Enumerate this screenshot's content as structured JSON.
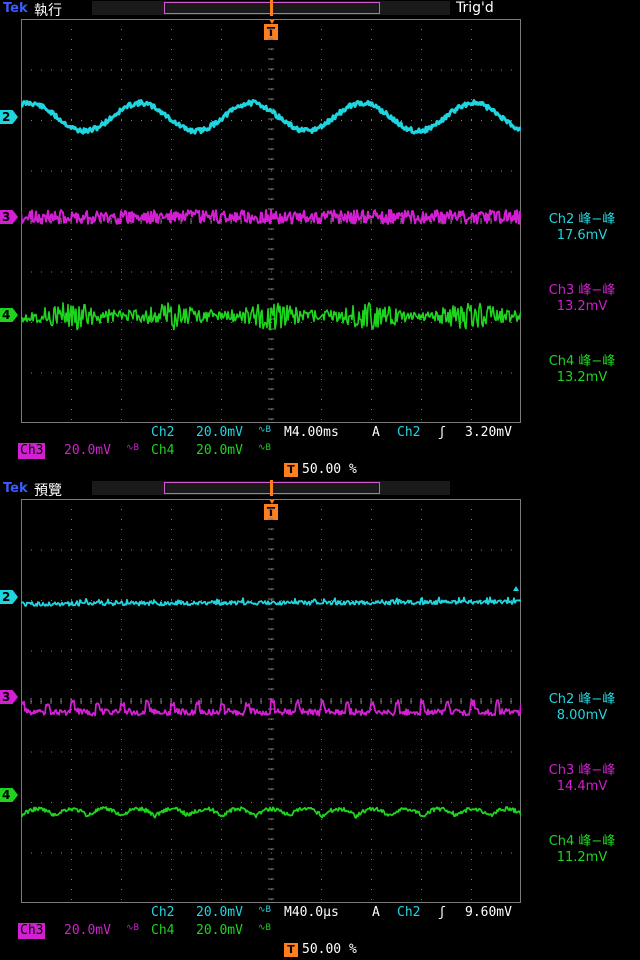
{
  "colors": {
    "ch2": "#1fd6e0",
    "ch3": "#d11fd1",
    "ch4": "#1ed41e",
    "trigger": "#ff7f1f",
    "grid": "#7a7a7a",
    "tek": "#3a5cff"
  },
  "panels": [
    {
      "logo": "Tek",
      "acq_state": "執行",
      "trig_state": "Trig'd",
      "trigger_marker": "T",
      "channel_markers": [
        "2",
        "3",
        "4"
      ],
      "waveforms": {
        "ch2": "sine",
        "ch3": "noise",
        "ch4": "amplitude-modulated"
      },
      "measurements": [
        {
          "title": "Ch2 峰−峰",
          "value": "17.6mV"
        },
        {
          "title": "Ch3 峰−峰",
          "value": "13.2mV"
        },
        {
          "title": "Ch4 峰−峰",
          "value": "13.2mV"
        }
      ],
      "ch2_label": "Ch2",
      "ch2_scale": "20.0mV",
      "bw_icon": "∿B",
      "timebase": "M4.00ms",
      "trig_source_letter": "A",
      "trig_ch": "Ch2",
      "trig_slope_icon": "ʃ",
      "trig_level": "3.20mV",
      "ch3_label": "Ch3",
      "ch3_scale": "20.0mV",
      "ch4_label": "Ch4",
      "ch4_scale": "20.0mV",
      "trig_pos_icon": "T",
      "trig_pos": "50.00 %"
    },
    {
      "logo": "Tek",
      "acq_state": "預覽",
      "trig_state": "",
      "trigger_marker": "T",
      "channel_markers": [
        "2",
        "3",
        "4"
      ],
      "waveforms": {
        "ch2": "flat-noise",
        "ch3": "ripple",
        "ch4": "ripple"
      },
      "measurements": [
        {
          "title": "Ch2 峰−峰",
          "value": "8.00mV"
        },
        {
          "title": "Ch3 峰−峰",
          "value": "14.4mV"
        },
        {
          "title": "Ch4 峰−峰",
          "value": "11.2mV"
        }
      ],
      "ch2_label": "Ch2",
      "ch2_scale": "20.0mV",
      "bw_icon": "∿B",
      "timebase": "M40.0µs",
      "trig_source_letter": "A",
      "trig_ch": "Ch2",
      "trig_slope_icon": "ʃ",
      "trig_level": "9.60mV",
      "ch3_label": "Ch3",
      "ch3_scale": "20.0mV",
      "ch4_label": "Ch4",
      "ch4_scale": "20.0mV",
      "trig_pos_icon": "T",
      "trig_pos": "50.00 %"
    }
  ]
}
